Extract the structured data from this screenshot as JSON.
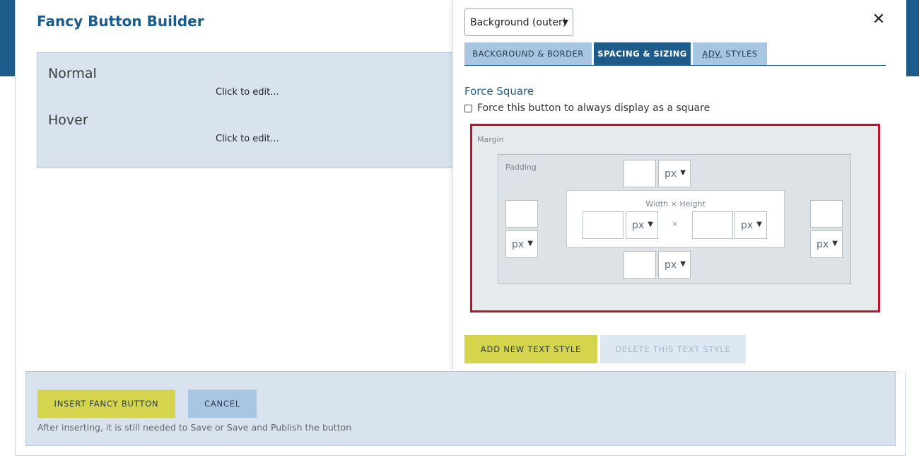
{
  "modal": {
    "title": "Fancy Button Builder"
  },
  "preview": {
    "normal_label": "Normal",
    "normal_hint": "Click to edit...",
    "hover_label": "Hover",
    "hover_hint": "Click to edit..."
  },
  "panel": {
    "element_select": "Background (outer)",
    "tabs": [
      {
        "label": "BACKGROUND & BORDER",
        "active": false
      },
      {
        "label": "SPACING & SIZING",
        "active": true
      },
      {
        "label_abbr": "ADV.",
        "label_rest": " STYLES",
        "active": false
      }
    ],
    "force_square": {
      "title": "Force Square",
      "checkbox_label": "Force this button to always display as a square",
      "checked": false
    },
    "box_model": {
      "margin_label": "Margin",
      "padding_label": "Padding",
      "size_label": "Width × Height",
      "times_symbol": "×",
      "padding_top_unit": "px",
      "padding_left_unit": "px",
      "padding_right_unit": "px",
      "padding_bottom_unit": "px",
      "width_unit": "px",
      "height_unit": "px"
    },
    "buttons": {
      "add_text_style": "ADD NEW TEXT STYLE",
      "delete_text_style": "DELETE THIS TEXT STYLE"
    }
  },
  "footer": {
    "insert_label": "INSERT FANCY BUTTON",
    "cancel_label": "CANCEL",
    "note": "After inserting, it is still needed to Save or Save and Publish the button"
  },
  "colors": {
    "brand_blue": "#1d5b8a",
    "accent_yellow": "#d4d54c",
    "highlight_red": "#c0122b",
    "light_blue": "#a8c5e2"
  }
}
